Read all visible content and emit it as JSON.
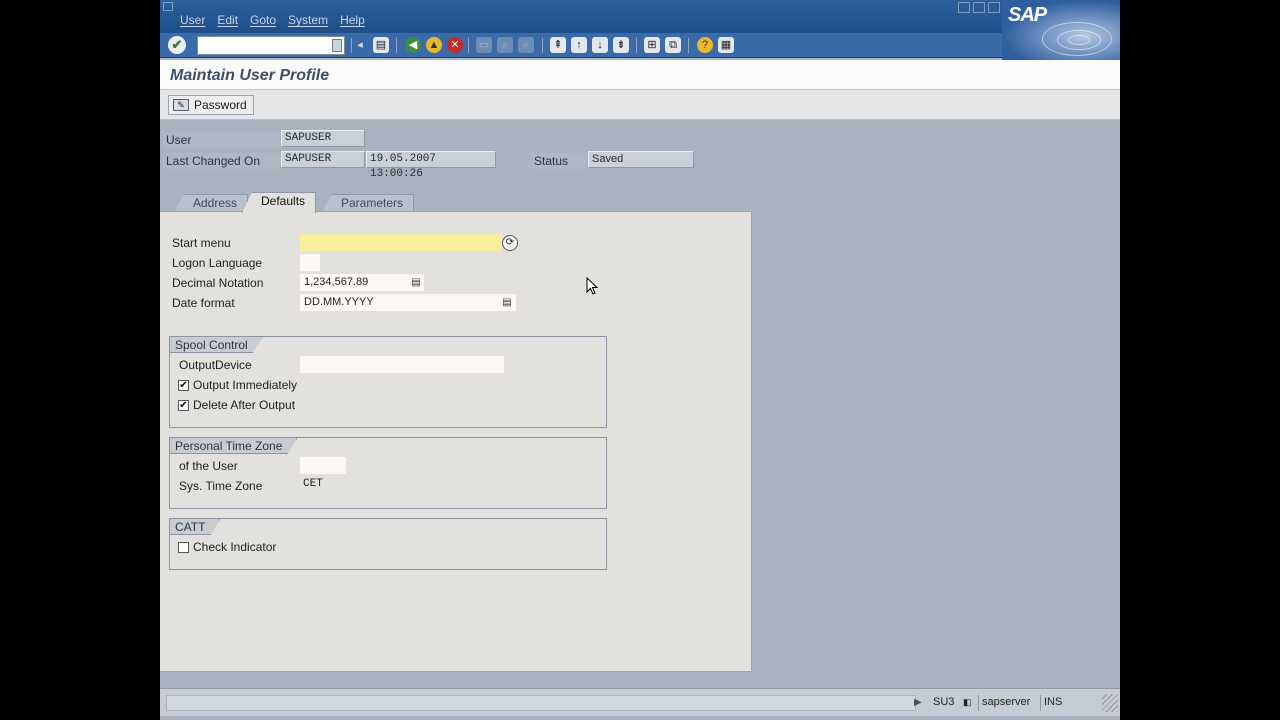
{
  "menu": {
    "items": [
      "User",
      "Edit",
      "Goto",
      "System",
      "Help"
    ],
    "logo": "SAP"
  },
  "toolbar": {
    "command_field_value": "",
    "icons": [
      "enter-icon",
      "save-icon",
      "back-icon",
      "exit-icon",
      "cancel-icon",
      "print-icon",
      "find-icon",
      "find-next-icon",
      "first-page-icon",
      "previous-page-icon",
      "next-page-icon",
      "last-page-icon",
      "create-session-icon",
      "shortcut-icon",
      "help-icon",
      "layout-menu-icon"
    ]
  },
  "title": "Maintain User Profile",
  "app_toolbar": {
    "password_label": "Password"
  },
  "header": {
    "user_label": "User",
    "user_value": "SAPUSER",
    "changed_label": "Last Changed On",
    "changed_by": "SAPUSER",
    "changed_datetime": "19.05.2007 13:00:26",
    "status_label": "Status",
    "status_value": "Saved"
  },
  "tabs": [
    {
      "label": "Address",
      "active": false
    },
    {
      "label": "Defaults",
      "active": true
    },
    {
      "label": "Parameters",
      "active": false
    }
  ],
  "defaults": {
    "start_menu_label": "Start menu",
    "start_menu_value": "",
    "logon_language_label": "Logon Language",
    "logon_language_value": "",
    "decimal_notation_label": "Decimal Notation",
    "decimal_notation_value": "1,234,567.89",
    "date_format_label": "Date format",
    "date_format_value": "DD.MM.YYYY"
  },
  "spool": {
    "title": "Spool Control",
    "output_device_label": "OutputDevice",
    "output_device_value": "",
    "output_immediately_label": "Output Immediately",
    "output_immediately_checked": true,
    "delete_after_output_label": "Delete After Output",
    "delete_after_output_checked": true
  },
  "timezone": {
    "title": "Personal Time Zone",
    "of_user_label": "of the User",
    "of_user_value": "",
    "sys_label": "Sys. Time Zone",
    "sys_value": "CET"
  },
  "catt": {
    "title": "CATT",
    "check_indicator_label": "Check Indicator",
    "check_indicator_checked": false
  },
  "status_bar": {
    "message": "",
    "transaction": "SU3",
    "server": "sapserver",
    "mode": "INS"
  }
}
